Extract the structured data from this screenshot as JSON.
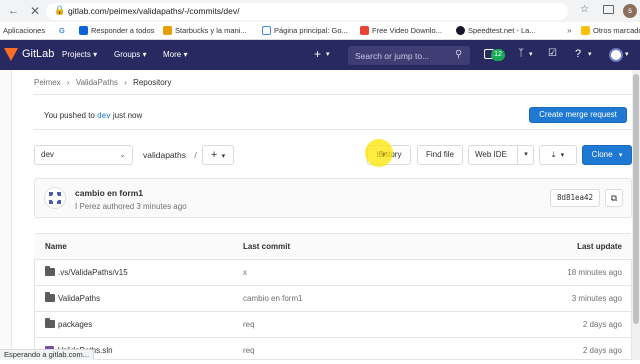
{
  "browser": {
    "url": "gitlab.com/peimex/validapaths/-/commits/dev/",
    "avatar_letter": "s",
    "bookmarks": [
      {
        "label": "Aplicaciones",
        "color": "#4285f4"
      },
      {
        "label": "G",
        "color": "#ffffff"
      },
      {
        "label": "Responder a todos",
        "color": "#0a64d8"
      },
      {
        "label": "Starbucks y la mani...",
        "color": "#e2a100"
      },
      {
        "label": "Página principal: Go...",
        "color": "#ffffff"
      },
      {
        "label": "Free Video Downlo...",
        "color": "#ea4335"
      },
      {
        "label": "Speedtest.net - La...",
        "color": "#141526"
      },
      {
        "label": "Otros marcado",
        "color": "#f9c10c"
      }
    ]
  },
  "gitlab_nav": {
    "logo_text": "GitLab",
    "items": [
      "Projects",
      "Groups",
      "More"
    ],
    "search_placeholder": "Search or jump to...",
    "issues_count": "12"
  },
  "breadcrumb": [
    "Peimex",
    "ValidaPaths",
    "Repository"
  ],
  "push_banner": {
    "text_prefix": "You pushed to",
    "branch": "dev",
    "text_suffix": "just now",
    "button": "Create merge request"
  },
  "toolbar": {
    "branch": "dev",
    "path": "validapaths",
    "path_sep": "/",
    "add_label": "+",
    "history": "History",
    "find_file": "Find file",
    "web_ide": "Web IDE",
    "clone": "Clone"
  },
  "commit": {
    "title": "cambio en form1",
    "author": "I Perez",
    "meta": "authored 3 minutes ago",
    "sha": "8d81ea42"
  },
  "table": {
    "headers": [
      "Name",
      "Last commit",
      "Last update"
    ],
    "rows": [
      {
        "name": ".vs/ValidaPaths/v15",
        "commit": "x",
        "update": "18 minutes ago"
      },
      {
        "name": "ValidaPaths",
        "commit": "cambio en form1",
        "update": "3 minutes ago"
      },
      {
        "name": "packages",
        "commit": "req",
        "update": "2 days ago"
      },
      {
        "name": "ValidaPaths.sln",
        "commit": "req",
        "update": "2 days ago"
      }
    ]
  },
  "status_bar": "Esperando a gitlab.com..."
}
